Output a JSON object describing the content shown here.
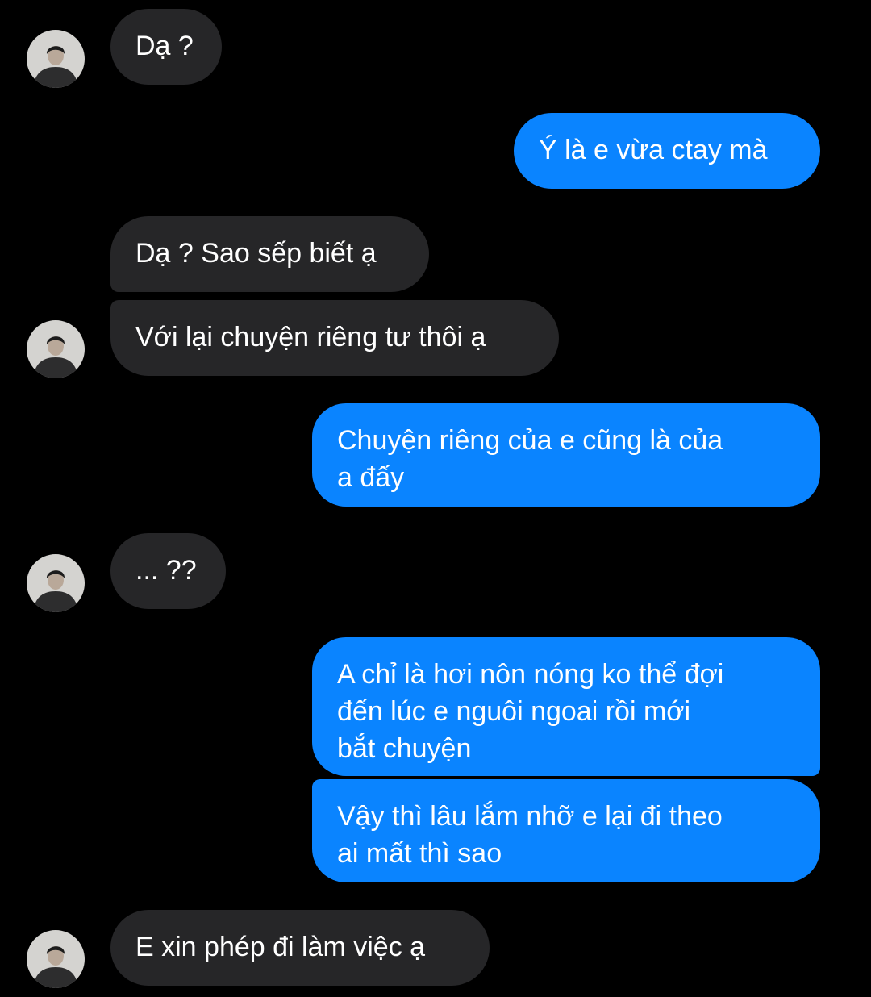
{
  "chat": {
    "messages": [
      {
        "sender": "them",
        "text": "Dạ ?"
      },
      {
        "sender": "me",
        "text": "Ý là e vừa ctay mà"
      },
      {
        "sender": "them",
        "text": "Dạ ? Sao sếp biết ạ"
      },
      {
        "sender": "them",
        "text": "Với lại chuyện riêng tư thôi ạ"
      },
      {
        "sender": "me",
        "text": "Chuyện riêng của e cũng là của\na đấy"
      },
      {
        "sender": "them",
        "text": "... ??"
      },
      {
        "sender": "me",
        "text": "A chỉ là hơi nôn nóng ko thể đợi\nđến lúc e nguôi ngoai rồi mới\nbắt chuyện"
      },
      {
        "sender": "me",
        "text": "Vậy thì lâu lắm nhỡ e lại đi theo\nai mất thì sao"
      },
      {
        "sender": "them",
        "text": "E xin phép đi làm việc ạ"
      }
    ]
  },
  "colors": {
    "background": "#000000",
    "received_bubble": "#262628",
    "sent_bubble": "#0a84ff",
    "text": "#ffffff"
  },
  "icons": {
    "avatar": "contact-avatar"
  }
}
